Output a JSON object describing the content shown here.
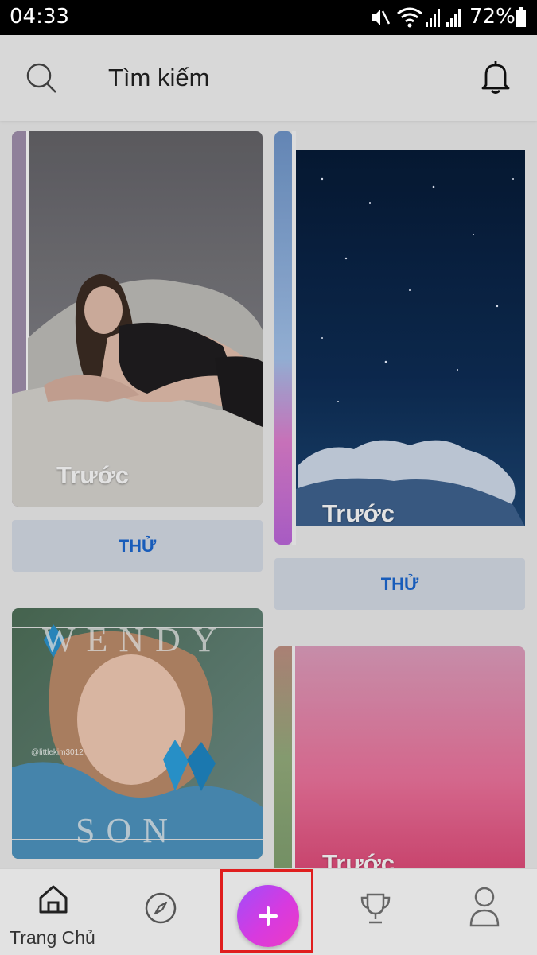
{
  "status_bar": {
    "time": "04:33",
    "battery_percent": "72%",
    "icons": [
      "mute-icon",
      "wifi-icon",
      "signal-icon",
      "signal-icon",
      "battery-icon"
    ]
  },
  "header": {
    "search_icon": "search-icon",
    "title": "Tìm kiếm",
    "bell_icon": "bell-icon"
  },
  "feed": {
    "cards": [
      {
        "label": "Trước",
        "button": "THỬ"
      },
      {
        "label": "Trước",
        "button": "THỬ"
      },
      {
        "label": "",
        "image_text_top": "WENDY",
        "image_text_bottom": "SON",
        "watermark": "@littlekim3012"
      },
      {
        "label": "Trước"
      }
    ]
  },
  "bottom_nav": {
    "items": [
      {
        "icon": "home-icon",
        "label": "Trang Chủ"
      },
      {
        "icon": "compass-icon",
        "label": ""
      },
      {
        "icon": "plus-icon",
        "label": ""
      },
      {
        "icon": "trophy-icon",
        "label": ""
      },
      {
        "icon": "profile-icon",
        "label": ""
      }
    ]
  },
  "colors": {
    "accent_blue": "#1a63c9",
    "fab_gradient": [
      "#a04dfb",
      "#ee3bc3"
    ],
    "highlight": "#e01e1e"
  }
}
